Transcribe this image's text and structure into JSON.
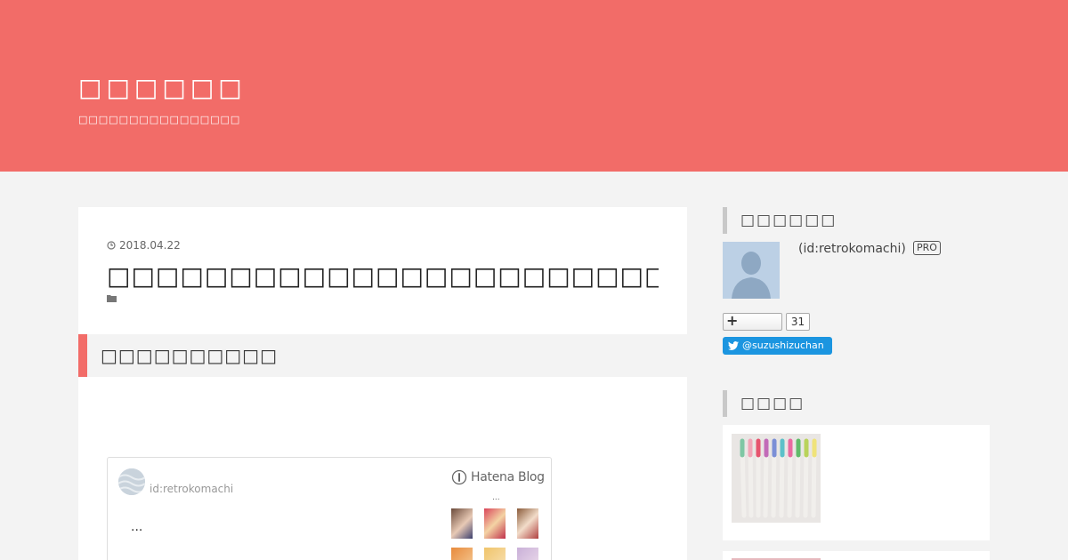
{
  "header": {
    "blog_title": "□□□□□□",
    "blog_description": "□□□□□□□□□□□□□□□□"
  },
  "entry": {
    "date": "2018.04.22",
    "title": "□□□□□□□□□□□□□□□□□□□□□□□□□□□□□□□□□",
    "section_heading": "□□□□□□□□□□"
  },
  "embed_card": {
    "user": "id:retrokomachi",
    "logo_text": "Hatena Blog",
    "dots": "...",
    "excerpt": "..."
  },
  "sidebar": {
    "profile_heading": "□□□□□□",
    "profile_id": "(id:retrokomachi)",
    "pro_badge": "PRO",
    "follow_plus": "+",
    "follower_count": "31",
    "twitter_handle": "@suzushizuchan",
    "recent_heading": "□□□□"
  },
  "colors": {
    "accent": "#f26c68",
    "background": "#f3f3f3",
    "twitter": "#1b95e0"
  }
}
